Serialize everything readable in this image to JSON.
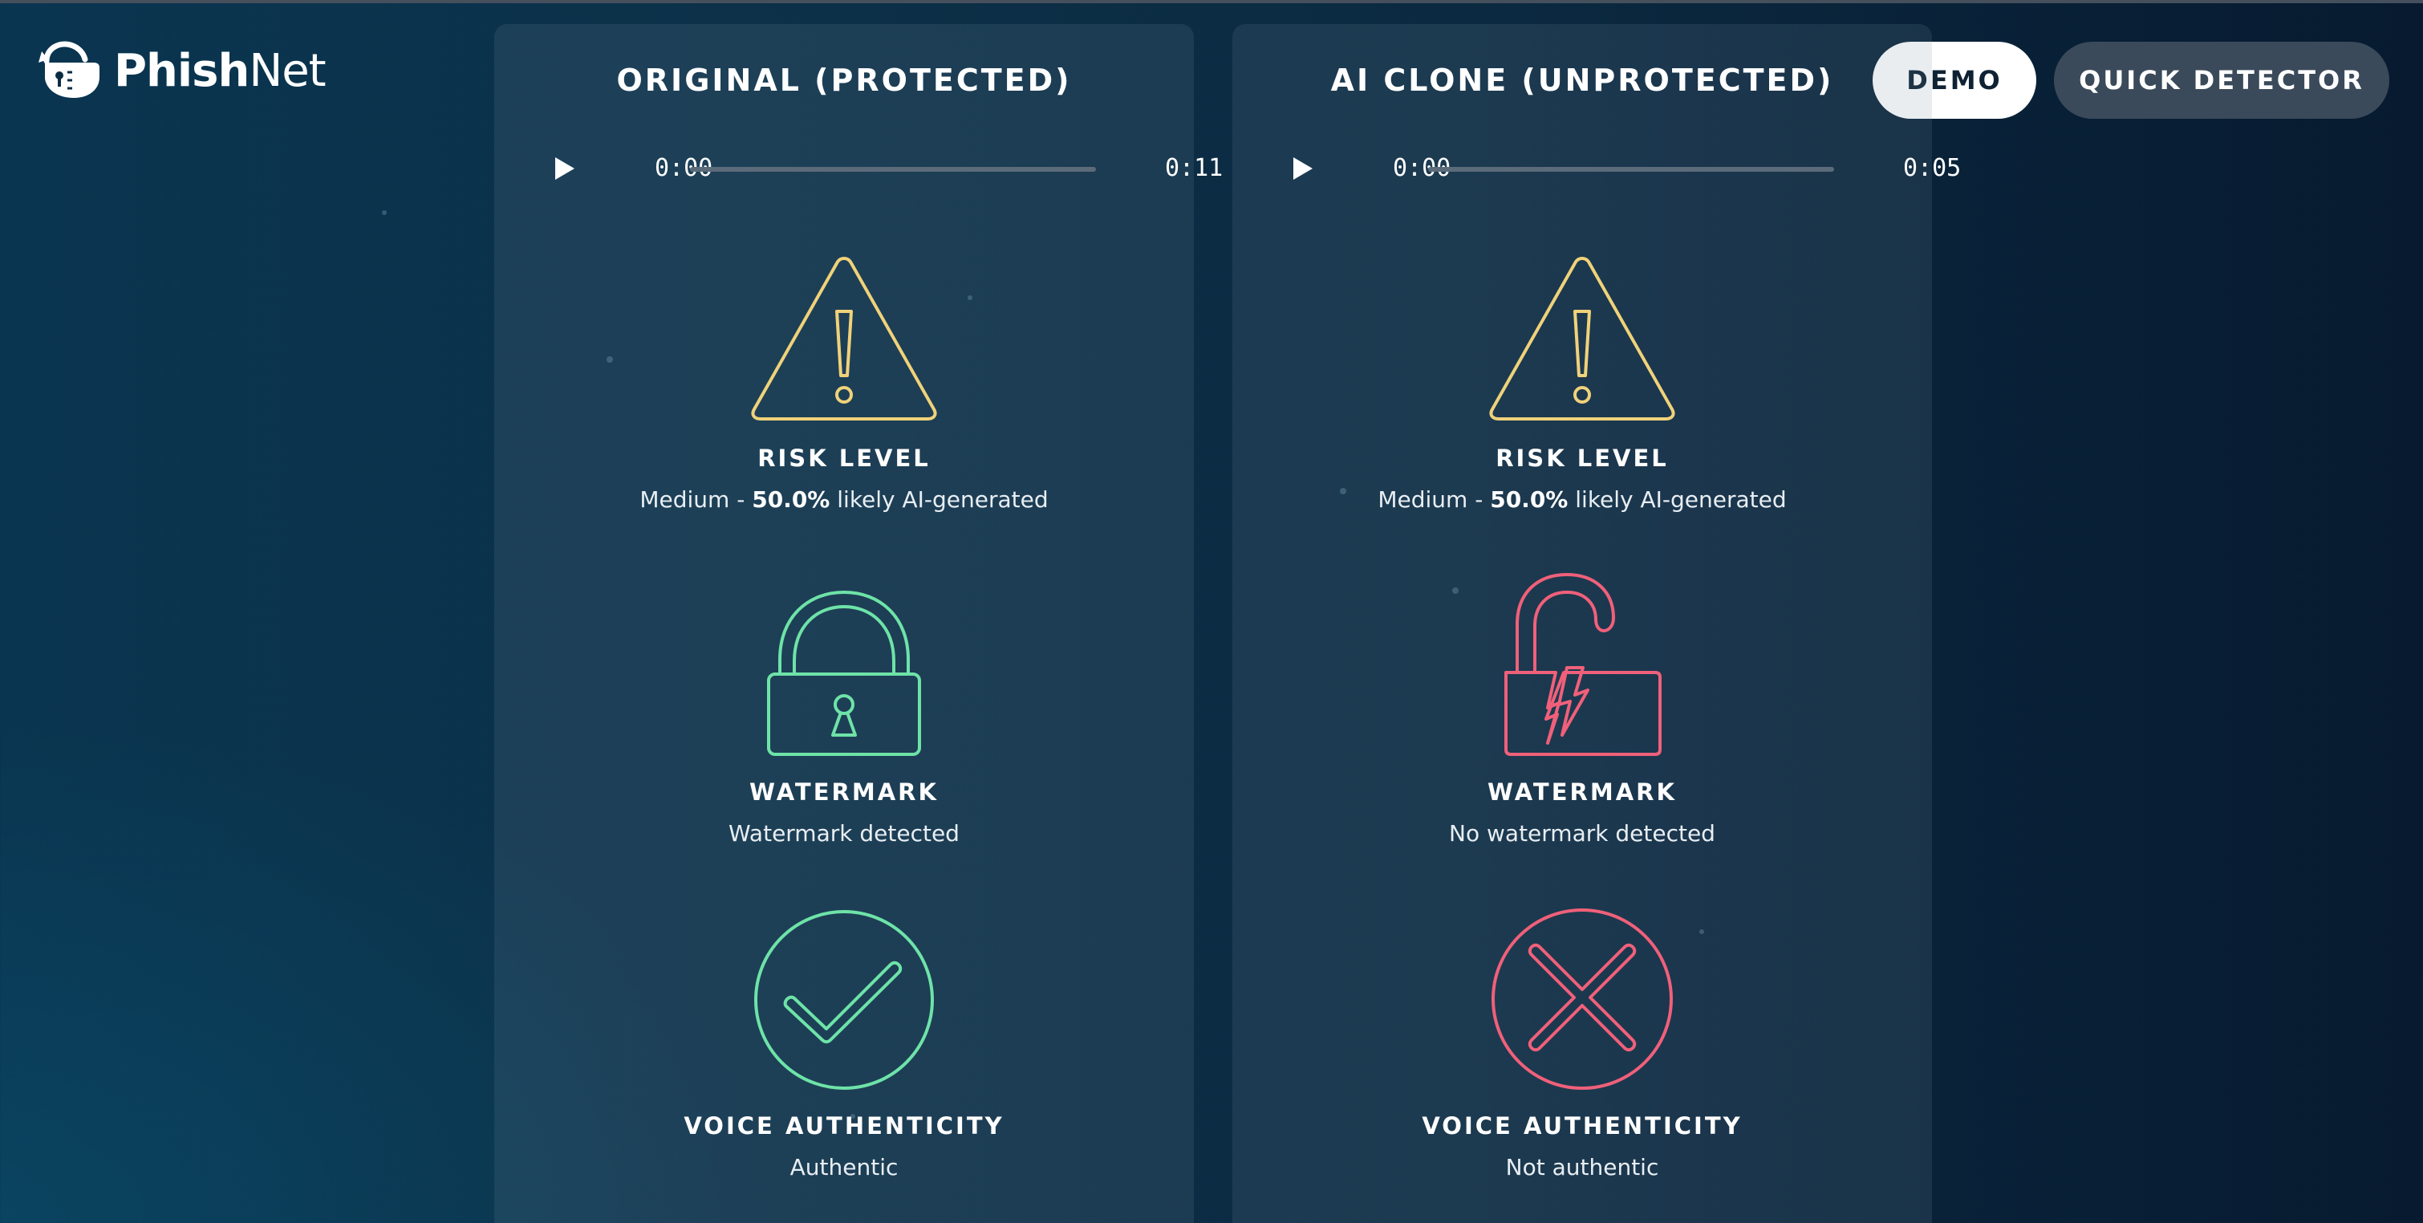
{
  "app": {
    "name_bold": "Phish",
    "name_regular": "Net"
  },
  "nav": {
    "demo_label": "DEMO",
    "quick_detector_label": "QUICK DETECTOR"
  },
  "colors": {
    "warning": "#f0d27a",
    "success": "#6ee3a8",
    "danger": "#f0607a"
  },
  "panels": [
    {
      "title": "ORIGINAL (PROTECTED)",
      "player": {
        "current": "0:00",
        "duration": "0:11",
        "progress": 0
      },
      "risk": {
        "label": "RISK LEVEL",
        "prefix": "Medium - ",
        "value": "50.0%",
        "suffix": " likely AI-generated",
        "icon": "warning-triangle-icon"
      },
      "watermark": {
        "label": "WATERMARK",
        "status": "Watermark detected",
        "icon": "lock-closed-icon"
      },
      "voice": {
        "label": "VOICE AUTHENTICITY",
        "status": "Authentic",
        "icon": "check-circle-icon"
      }
    },
    {
      "title": "AI CLONE (UNPROTECTED)",
      "player": {
        "current": "0:00",
        "duration": "0:05",
        "progress": 0
      },
      "risk": {
        "label": "RISK LEVEL",
        "prefix": "Medium - ",
        "value": "50.0%",
        "suffix": " likely AI-generated",
        "icon": "warning-triangle-icon"
      },
      "watermark": {
        "label": "WATERMARK",
        "status": "No watermark detected",
        "icon": "lock-broken-icon"
      },
      "voice": {
        "label": "VOICE AUTHENTICITY",
        "status": "Not authentic",
        "icon": "x-circle-icon"
      }
    }
  ]
}
